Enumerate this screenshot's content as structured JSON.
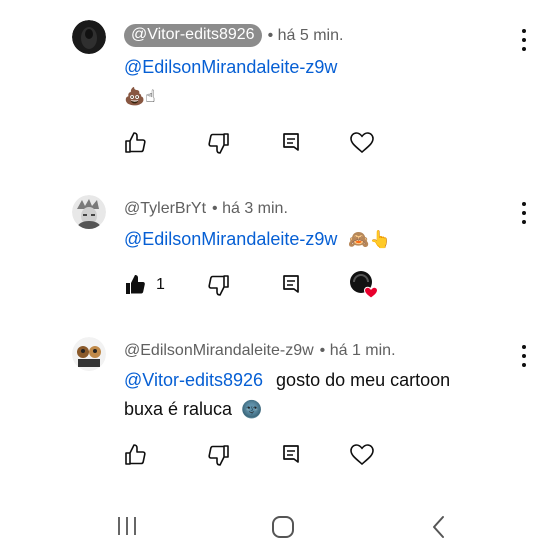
{
  "comments": [
    {
      "author": "@Vitor-edits8926",
      "time": "• há 5 min.",
      "mention": "@EdilsonMirandaleite-z9w",
      "emojis": "💩☝"
    },
    {
      "author": "@TylerBrYt",
      "time": "• há 3 min.",
      "mention": "@EdilsonMirandaleite-z9w",
      "emojis": "🙈👆",
      "like_count": "1"
    },
    {
      "author": "@EdilsonMirandaleite-z9w",
      "time": "• há 1 min.",
      "mention": "@Vitor-edits8926",
      "text_line1": "gosto do meu  cartoon",
      "text_line2": "buxa é raluca",
      "emoji_end": "🌚"
    }
  ],
  "icons": [
    "like-icon",
    "dislike-icon",
    "reply-icon",
    "heart-icon",
    "more-options-icon",
    "recent-apps-icon",
    "home-icon",
    "back-icon"
  ],
  "colors": {
    "mention": "#065fd4",
    "author_chip": "#8c8c8c",
    "heart": "#e8002d"
  }
}
